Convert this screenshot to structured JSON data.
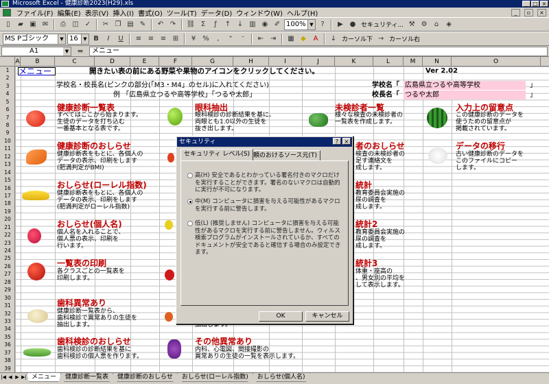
{
  "app": {
    "title": "Microsoft Excel - 健康診断2023(H29).xls"
  },
  "menu": [
    "ファイル(F)",
    "編集(E)",
    "表示(V)",
    "挿入(I)",
    "書式(O)",
    "ツール(T)",
    "データ(D)",
    "ウィンドウ(W)",
    "ヘルプ(H)"
  ],
  "toolbar": {
    "zoom": "100%",
    "security_label": "セキュリティ...",
    "font_name": "MS Pゴシック",
    "font_size": "16",
    "cursor_down": "カーソル下",
    "cursor_right": "カーソル右"
  },
  "formula_bar": {
    "cell_ref": "A1",
    "eq": "=",
    "content": "メニュー"
  },
  "columns": [
    "A",
    "B",
    "C",
    "D",
    "E",
    "F",
    "G",
    "H",
    "I",
    "J",
    "K",
    "L",
    "M",
    "N",
    "O"
  ],
  "rows": [
    "1",
    "2",
    "3",
    "4",
    "5",
    "6",
    "7",
    "8",
    "9",
    "10",
    "11",
    "12",
    "13",
    "14",
    "15",
    "16",
    "17",
    "18",
    "19",
    "20",
    "21",
    "22",
    "23",
    "24",
    "25",
    "26",
    "27",
    "28",
    "29",
    "30",
    "31",
    "32",
    "33",
    "34",
    "35",
    "36",
    "37",
    "38",
    "39"
  ],
  "sheet": {
    "menu_link": "メニュー",
    "instruction": "開きたい表の前にある野菜や果物のアイコンをクリックしてください。",
    "version": "Ver 2.02",
    "school_note": "学校名・校長名(ピンクの部分(「M3・M4」のセル)に入れてください)",
    "example": "例 「広島県立つるや高等学校」「つるや太郎」",
    "school_label": "学校名「",
    "school_value": "広島県立つるや高等学校",
    "principal_label": "校長名「",
    "principal_value": "つるや太郎",
    "close_bracket": "」",
    "items": [
      {
        "title": "健康診断一覧表",
        "desc": "すべてはここから始まります。\n生徒のデータを打ち込む\n一番基本となる表です。"
      },
      {
        "title": "眼科抽出",
        "desc": "眼科検診の診断結果を基に、\n両眼とも1.0以外の生徒を\n抜き出します。"
      },
      {
        "title": "未検診者一覧",
        "desc": "様々な検査の未検診者の\n一覧表を作成します。"
      },
      {
        "title": "入力上の留意点",
        "desc": "この健康診断のデータを\n使うための留意点が\n掲載されています。"
      },
      {
        "title": "健康診断のおしらせ",
        "desc": "健康診断表をもとに、各個人の\nデータの表示、印刷をします\n(肥満判定がBMI)"
      },
      {
        "title": "者のおしらせ",
        "desc": "検査の未検診者の\n足す連絡文を\n成します。"
      },
      {
        "title": "データの移行",
        "desc": "古い健康診断のデータを\nこのファイルにコピー\nします。"
      },
      {
        "title": "おしらせ(ローレル指数)",
        "desc": "健康診断表をもとに、各個人の\nデータの表示、印刷をします\n(肥満判定がローレル指数)"
      },
      {
        "title": "統計",
        "desc": "教育委員会実施の\n尿の調査を\n成します。"
      },
      {
        "title": "おしらせ(個人名)",
        "desc": "個人名を入れることで、\n個人票の表示、印刷を\n行います。"
      },
      {
        "title": "統計2",
        "desc": "教育委員会実施の\n尿の調査を\n成します。"
      },
      {
        "title": "一覧表の印刷",
        "desc": "各クラスごとの一覧表を\n印刷します。"
      },
      {
        "title": "統計3",
        "desc": "体重・座高の\n、男女別の平均を\nして表示します。"
      },
      {
        "title": "歯科異常あり",
        "desc": "健康診断一覧表から、\n歯科検診で異常ありの生徒を\n抽出します。"
      },
      {
        "title": "",
        "desc": "抽出します。"
      },
      {
        "title": "歯科検診のおしらせ",
        "desc": "歯科検診の診断結果を基に\n歯科検診の個人票を作ります。"
      },
      {
        "title": "その他異常あり",
        "desc": "内科、心電図、間接撮影の\n異常ありの生徒の一覧を表示します。"
      }
    ]
  },
  "dialog": {
    "title": "セキュリティ",
    "help": "?",
    "close": "×",
    "tab1": "セキュリティ レベル(S)",
    "tab2": "信頼のおけるソース元(T)",
    "opt_high": "高(H) 安全であるとわかっている署名付きのマクロだけを実行することができます。署名のないマクロは自動的に実行が不可になります。",
    "opt_medium": "中(M) コンピュータに損害を与える可能性があるマクロを実行する前に警告します。",
    "opt_low": "低(L) (推奨しません) コンピュータに損害を与える可能性があるマクロを実行する前に警告しません。ウィルス検索プログラムがインストールされているか、すべてのドキュメントが安全であると確信する場合のみ設定できます。",
    "ok": "OK",
    "cancel": "キャンセル"
  },
  "sheet_tabs": [
    "メニュー",
    "健康診断一覧表",
    "健康診断のおしらせ",
    "おしらせ(ローレル指数)",
    "おしらせ(個人名)"
  ],
  "colors": {
    "title_bar": "#0a246a",
    "heading_red": "#c00000",
    "link_blue": "#0000cc"
  }
}
